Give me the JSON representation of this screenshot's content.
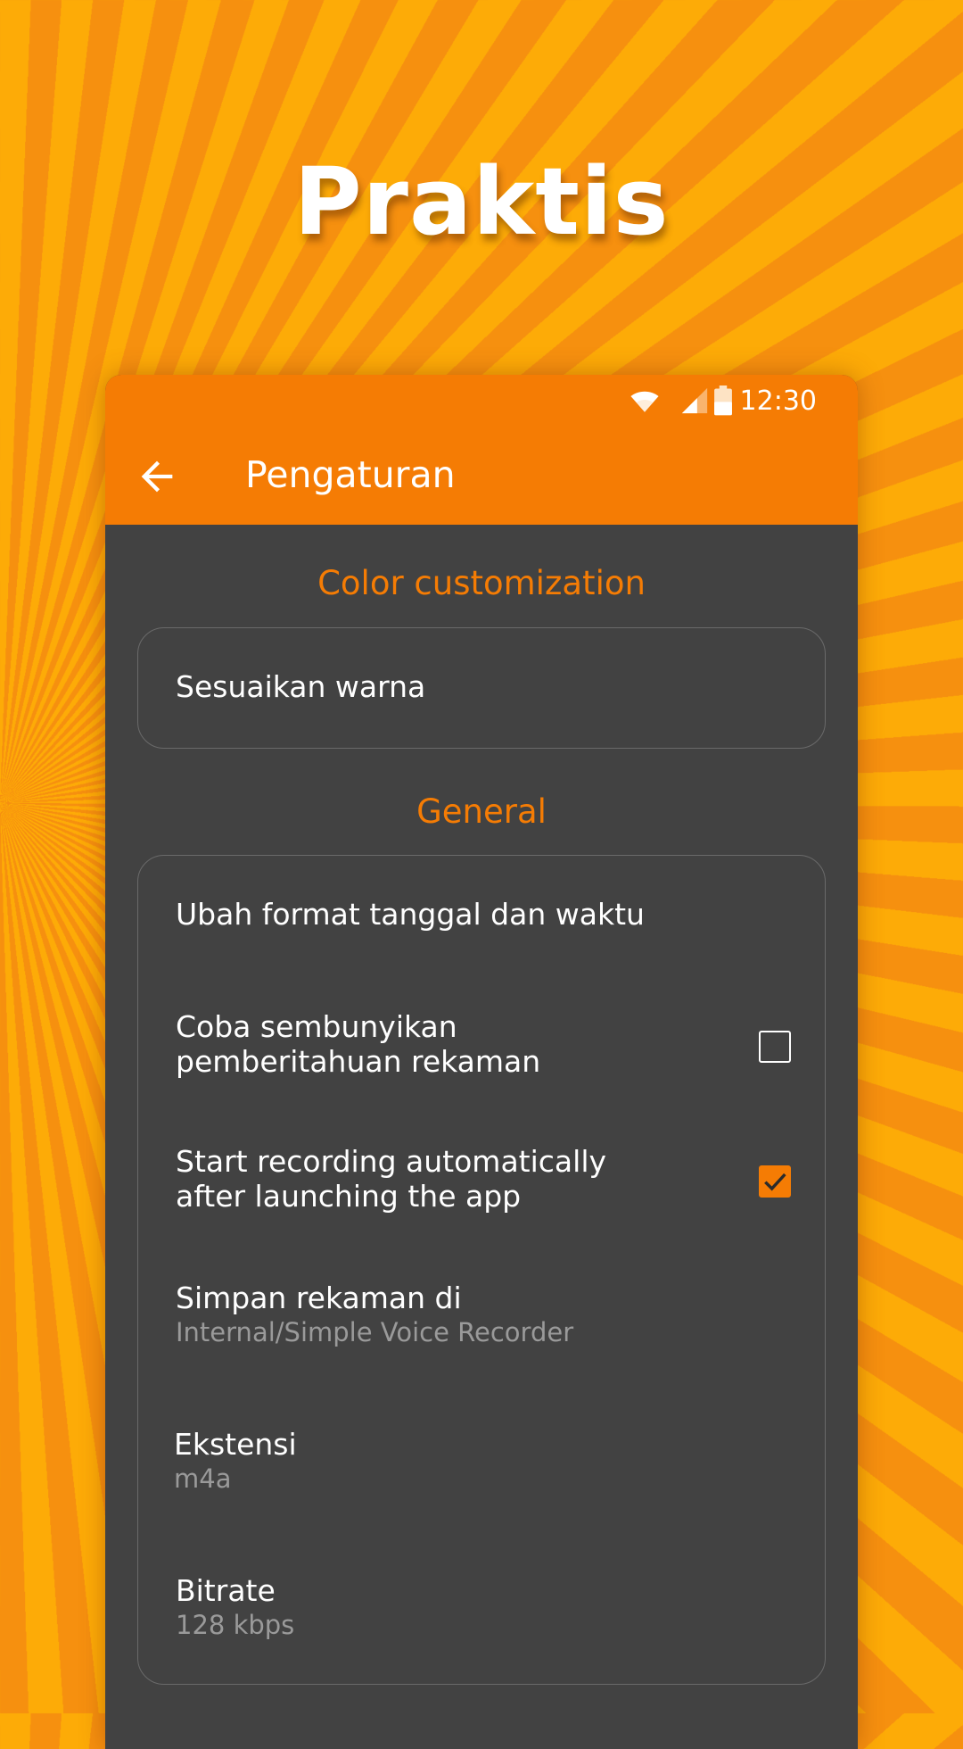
{
  "headline": "Praktis",
  "status_bar": {
    "time": "12:30",
    "icons": [
      "wifi-icon",
      "signal-icon",
      "battery-icon"
    ]
  },
  "toolbar": {
    "title": "Pengaturan",
    "back_icon": "arrow-back-icon"
  },
  "colors": {
    "accent": "#f57c04",
    "panel": "#424242",
    "secondary_text": "#9a9a9a"
  },
  "sections": {
    "color": {
      "header": "Color customization",
      "items": {
        "customize": "Sesuaikan warna"
      }
    },
    "general": {
      "header": "General",
      "date_format": "Ubah format tanggal dan waktu",
      "hide_notification": {
        "label": "Coba sembunyikan pemberitahuan rekaman",
        "checked": false
      },
      "auto_record": {
        "label": "Start recording automatically after launching the  app",
        "checked": true
      },
      "save_location": {
        "label": "Simpan rekaman di",
        "value": "Internal/Simple Voice Recorder"
      },
      "extension": {
        "label": "Ekstensi",
        "value": "m4a"
      },
      "bitrate": {
        "label": "Bitrate",
        "value": "128 kbps"
      }
    }
  }
}
